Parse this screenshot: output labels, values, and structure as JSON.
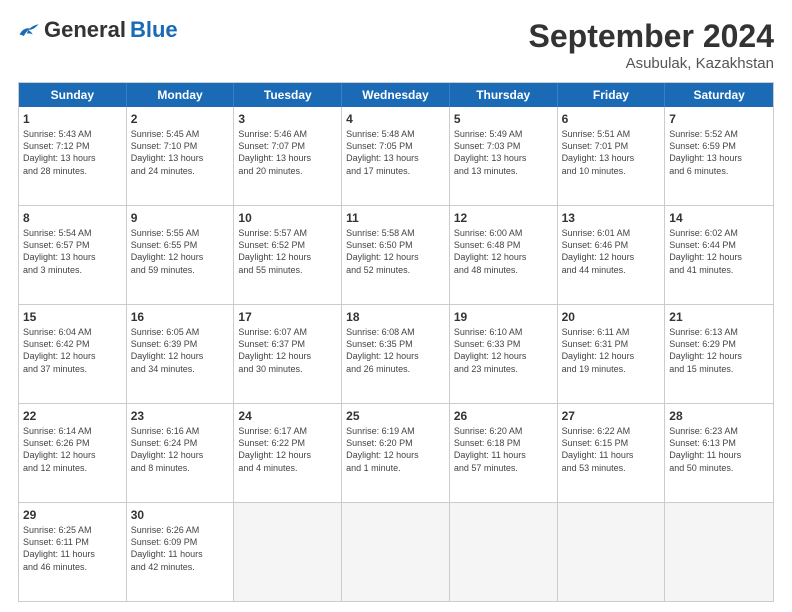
{
  "logo": {
    "general": "General",
    "blue": "Blue"
  },
  "header": {
    "month": "September 2024",
    "location": "Asubulak, Kazakhstan"
  },
  "weekdays": [
    "Sunday",
    "Monday",
    "Tuesday",
    "Wednesday",
    "Thursday",
    "Friday",
    "Saturday"
  ],
  "rows": [
    [
      {
        "day": "1",
        "lines": [
          "Sunrise: 5:43 AM",
          "Sunset: 7:12 PM",
          "Daylight: 13 hours",
          "and 28 minutes."
        ]
      },
      {
        "day": "2",
        "lines": [
          "Sunrise: 5:45 AM",
          "Sunset: 7:10 PM",
          "Daylight: 13 hours",
          "and 24 minutes."
        ]
      },
      {
        "day": "3",
        "lines": [
          "Sunrise: 5:46 AM",
          "Sunset: 7:07 PM",
          "Daylight: 13 hours",
          "and 20 minutes."
        ]
      },
      {
        "day": "4",
        "lines": [
          "Sunrise: 5:48 AM",
          "Sunset: 7:05 PM",
          "Daylight: 13 hours",
          "and 17 minutes."
        ]
      },
      {
        "day": "5",
        "lines": [
          "Sunrise: 5:49 AM",
          "Sunset: 7:03 PM",
          "Daylight: 13 hours",
          "and 13 minutes."
        ]
      },
      {
        "day": "6",
        "lines": [
          "Sunrise: 5:51 AM",
          "Sunset: 7:01 PM",
          "Daylight: 13 hours",
          "and 10 minutes."
        ]
      },
      {
        "day": "7",
        "lines": [
          "Sunrise: 5:52 AM",
          "Sunset: 6:59 PM",
          "Daylight: 13 hours",
          "and 6 minutes."
        ]
      }
    ],
    [
      {
        "day": "8",
        "lines": [
          "Sunrise: 5:54 AM",
          "Sunset: 6:57 PM",
          "Daylight: 13 hours",
          "and 3 minutes."
        ]
      },
      {
        "day": "9",
        "lines": [
          "Sunrise: 5:55 AM",
          "Sunset: 6:55 PM",
          "Daylight: 12 hours",
          "and 59 minutes."
        ]
      },
      {
        "day": "10",
        "lines": [
          "Sunrise: 5:57 AM",
          "Sunset: 6:52 PM",
          "Daylight: 12 hours",
          "and 55 minutes."
        ]
      },
      {
        "day": "11",
        "lines": [
          "Sunrise: 5:58 AM",
          "Sunset: 6:50 PM",
          "Daylight: 12 hours",
          "and 52 minutes."
        ]
      },
      {
        "day": "12",
        "lines": [
          "Sunrise: 6:00 AM",
          "Sunset: 6:48 PM",
          "Daylight: 12 hours",
          "and 48 minutes."
        ]
      },
      {
        "day": "13",
        "lines": [
          "Sunrise: 6:01 AM",
          "Sunset: 6:46 PM",
          "Daylight: 12 hours",
          "and 44 minutes."
        ]
      },
      {
        "day": "14",
        "lines": [
          "Sunrise: 6:02 AM",
          "Sunset: 6:44 PM",
          "Daylight: 12 hours",
          "and 41 minutes."
        ]
      }
    ],
    [
      {
        "day": "15",
        "lines": [
          "Sunrise: 6:04 AM",
          "Sunset: 6:42 PM",
          "Daylight: 12 hours",
          "and 37 minutes."
        ]
      },
      {
        "day": "16",
        "lines": [
          "Sunrise: 6:05 AM",
          "Sunset: 6:39 PM",
          "Daylight: 12 hours",
          "and 34 minutes."
        ]
      },
      {
        "day": "17",
        "lines": [
          "Sunrise: 6:07 AM",
          "Sunset: 6:37 PM",
          "Daylight: 12 hours",
          "and 30 minutes."
        ]
      },
      {
        "day": "18",
        "lines": [
          "Sunrise: 6:08 AM",
          "Sunset: 6:35 PM",
          "Daylight: 12 hours",
          "and 26 minutes."
        ]
      },
      {
        "day": "19",
        "lines": [
          "Sunrise: 6:10 AM",
          "Sunset: 6:33 PM",
          "Daylight: 12 hours",
          "and 23 minutes."
        ]
      },
      {
        "day": "20",
        "lines": [
          "Sunrise: 6:11 AM",
          "Sunset: 6:31 PM",
          "Daylight: 12 hours",
          "and 19 minutes."
        ]
      },
      {
        "day": "21",
        "lines": [
          "Sunrise: 6:13 AM",
          "Sunset: 6:29 PM",
          "Daylight: 12 hours",
          "and 15 minutes."
        ]
      }
    ],
    [
      {
        "day": "22",
        "lines": [
          "Sunrise: 6:14 AM",
          "Sunset: 6:26 PM",
          "Daylight: 12 hours",
          "and 12 minutes."
        ]
      },
      {
        "day": "23",
        "lines": [
          "Sunrise: 6:16 AM",
          "Sunset: 6:24 PM",
          "Daylight: 12 hours",
          "and 8 minutes."
        ]
      },
      {
        "day": "24",
        "lines": [
          "Sunrise: 6:17 AM",
          "Sunset: 6:22 PM",
          "Daylight: 12 hours",
          "and 4 minutes."
        ]
      },
      {
        "day": "25",
        "lines": [
          "Sunrise: 6:19 AM",
          "Sunset: 6:20 PM",
          "Daylight: 12 hours",
          "and 1 minute."
        ]
      },
      {
        "day": "26",
        "lines": [
          "Sunrise: 6:20 AM",
          "Sunset: 6:18 PM",
          "Daylight: 11 hours",
          "and 57 minutes."
        ]
      },
      {
        "day": "27",
        "lines": [
          "Sunrise: 6:22 AM",
          "Sunset: 6:15 PM",
          "Daylight: 11 hours",
          "and 53 minutes."
        ]
      },
      {
        "day": "28",
        "lines": [
          "Sunrise: 6:23 AM",
          "Sunset: 6:13 PM",
          "Daylight: 11 hours",
          "and 50 minutes."
        ]
      }
    ],
    [
      {
        "day": "29",
        "lines": [
          "Sunrise: 6:25 AM",
          "Sunset: 6:11 PM",
          "Daylight: 11 hours",
          "and 46 minutes."
        ]
      },
      {
        "day": "30",
        "lines": [
          "Sunrise: 6:26 AM",
          "Sunset: 6:09 PM",
          "Daylight: 11 hours",
          "and 42 minutes."
        ]
      },
      {
        "day": "",
        "lines": [],
        "empty": true
      },
      {
        "day": "",
        "lines": [],
        "empty": true
      },
      {
        "day": "",
        "lines": [],
        "empty": true
      },
      {
        "day": "",
        "lines": [],
        "empty": true
      },
      {
        "day": "",
        "lines": [],
        "empty": true
      }
    ]
  ]
}
